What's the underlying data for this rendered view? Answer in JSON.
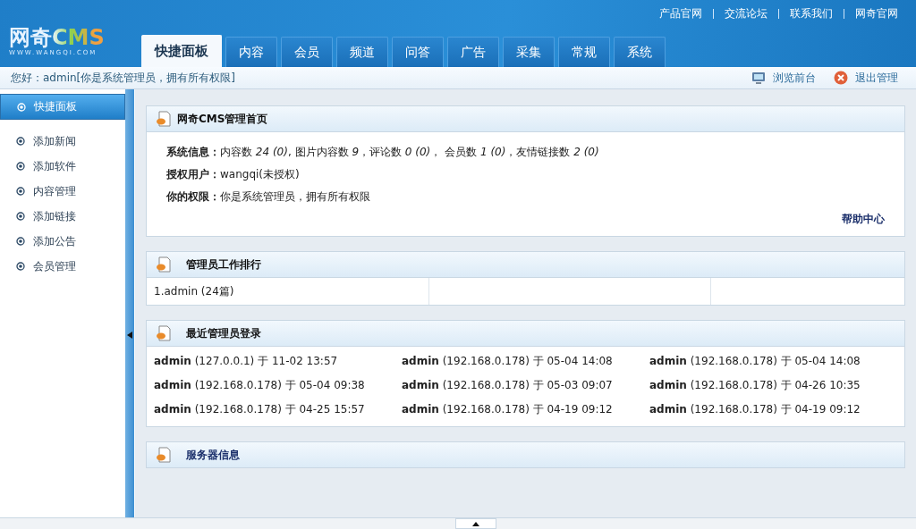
{
  "header": {
    "logo": {
      "name": "网奇CMS",
      "url": "WWW.WANGQI.COM"
    },
    "top_links": [
      "产品官网",
      "交流论坛",
      "联系我们",
      "网奇官网"
    ],
    "tabs": [
      {
        "label": "快捷面板",
        "selected": true
      },
      {
        "label": "内容",
        "selected": false
      },
      {
        "label": "会员",
        "selected": false
      },
      {
        "label": "频道",
        "selected": false
      },
      {
        "label": "问答",
        "selected": false
      },
      {
        "label": "广告",
        "selected": false
      },
      {
        "label": "采集",
        "selected": false
      },
      {
        "label": "常规",
        "selected": false
      },
      {
        "label": "系统",
        "selected": false
      }
    ]
  },
  "info_bar": {
    "greeting": "您好：admin[你是系统管理员，拥有所有权限]",
    "actions": [
      {
        "kind": "monitor",
        "label": "浏览前台"
      },
      {
        "kind": "exit",
        "label": "退出管理"
      }
    ]
  },
  "sidebar": {
    "items": [
      {
        "label": "快捷面板",
        "selected": true
      },
      {
        "label": "添加新闻",
        "selected": false
      },
      {
        "label": "添加软件",
        "selected": false
      },
      {
        "label": "内容管理",
        "selected": false
      },
      {
        "label": "添加链接",
        "selected": false
      },
      {
        "label": "添加公告",
        "selected": false
      },
      {
        "label": "会员管理",
        "selected": false
      }
    ]
  },
  "home_panel": {
    "title": "网奇CMS管理首页",
    "rows": [
      {
        "label": "系统信息：",
        "value": "内容数 *24 (0)*,  图片内容数 *9*，评论数 *0 (0)*， 会员数 *1 (0)*，友情链接数 *2 (0)*"
      },
      {
        "label": "授权用户：",
        "value": " wangqi(未授权)"
      },
      {
        "label": "你的权限：",
        "value": "你是系统管理员，拥有所有权限"
      }
    ],
    "help_link": "帮助中心"
  },
  "ranking_panel": {
    "title": "管理员工作排行",
    "cells": [
      "1.admin (24篇)"
    ]
  },
  "login_panel": {
    "title": "最近管理员登录",
    "entries": [
      {
        "user": "admin",
        "detail": "(127.0.0.1) 于 11-02 13:57"
      },
      {
        "user": "admin",
        "detail": "(192.168.0.178) 于 05-04 14:08"
      },
      {
        "user": "admin",
        "detail": "(192.168.0.178) 于 05-04 14:08"
      },
      {
        "user": "admin",
        "detail": "(192.168.0.178) 于 05-04 09:38"
      },
      {
        "user": "admin",
        "detail": "(192.168.0.178) 于 05-03 09:07"
      },
      {
        "user": "admin",
        "detail": "(192.168.0.178) 于 04-26 10:35"
      },
      {
        "user": "admin",
        "detail": "(192.168.0.178) 于 04-25 15:57"
      },
      {
        "user": "admin",
        "detail": "(192.168.0.178) 于 04-19 09:12"
      },
      {
        "user": "admin",
        "detail": "(192.168.0.178) 于 04-19 09:12"
      }
    ]
  },
  "server_panel": {
    "title": "服务器信息"
  }
}
